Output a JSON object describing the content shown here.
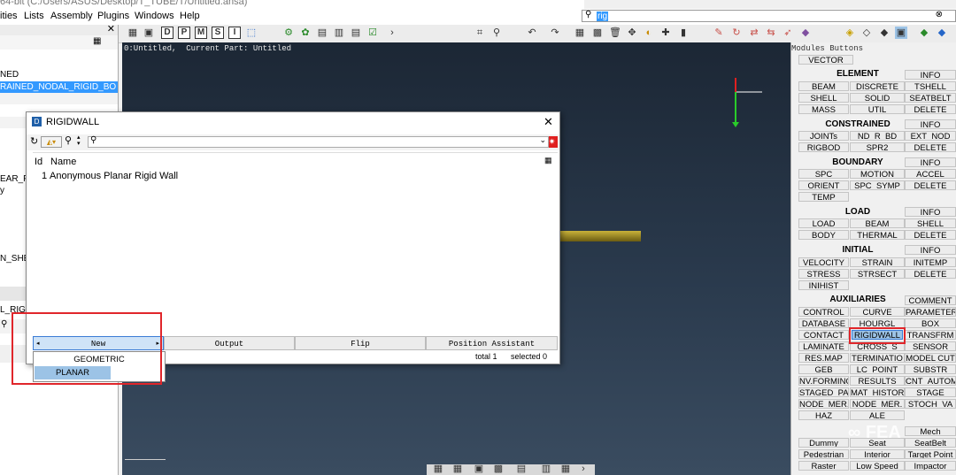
{
  "window": {
    "title": "64-bit (C:/Users/ASUS/Desktop/T_TUBE/T/Untitled.ansa)"
  },
  "menu": [
    "ities",
    "Lists",
    "Assembly",
    "Plugins",
    "Windows",
    "Help"
  ],
  "search": {
    "value": "rig"
  },
  "left_panel": {
    "rows": [
      "NED",
      "RAINED_NODAL_RIGID_BO",
      "EAR_P",
      "y",
      "N_SHEL",
      "L_RIGI"
    ],
    "selected_index": 1
  },
  "viewport": {
    "info": "0:Untitled,  Current Part: Untitled"
  },
  "right_panel": {
    "header": "Modules Buttons",
    "top": "VECTOR",
    "sections": {
      "element": "ELEMENT",
      "constrained": "CONSTRAINED",
      "boundary": "BOUNDARY",
      "load": "LOAD",
      "initial": "INITIAL",
      "auxiliaries": "AUXILIARIES"
    },
    "buttons": {
      "beam": "BEAM",
      "discrete": "DISCRETE",
      "tshell": "TSHELL",
      "info1": "INFO",
      "shell": "SHELL",
      "solid": "SOLID",
      "seatbelt": "SEATBELT",
      "mass": "MASS",
      "util": "UTIL",
      "delete1": "DELETE",
      "info2": "INFO",
      "joints": "JOINTs",
      "nd_r_bd": "ND_R_BD",
      "ext_nod": "EXT_NOD",
      "rigbod": "RIGBOD",
      "spr2": "SPR2",
      "delete2": "DELETE",
      "info3": "INFO",
      "spc": "SPC",
      "motion": "MOTION",
      "accel": "ACCEL",
      "orient": "ORIENT",
      "spc_symp": "SPC_SYMP",
      "delete3": "DELETE",
      "temp": "TEMP",
      "info4": "INFO",
      "load": "LOAD",
      "beam2": "BEAM",
      "shell2": "SHELL",
      "body": "BODY",
      "thermal": "THERMAL",
      "delete4": "DELETE",
      "info5": "INFO",
      "velocity": "VELOCITY",
      "strain": "STRAIN",
      "initemp": "INITEMP",
      "stress": "STRESS",
      "strsect": "STRSECT",
      "delete5": "DELETE",
      "inihist": "INIHIST",
      "comment": "COMMENT",
      "control": "CONTROL",
      "curve": "CURVE",
      "parameter": "PARAMETER",
      "database": "DATABASE",
      "hourgl": "HOURGL",
      "box": "BOX",
      "contact": "CONTACT",
      "rigidwall": "RIGIDWALL",
      "transfrm": "TRANSFRM",
      "laminate": "LAMINATE",
      "cross_s": "CROSS_S",
      "sensor": "SENSOR",
      "resmap": "RES.MAP",
      "terminatio": "TERMINATIO",
      "modelcut": "MODEL CUT",
      "geb": "GEB",
      "lc_point": "LC_POINT",
      "substr": "SUBSTR",
      "nvforming": "NV.FORMING",
      "results": "RESULTS",
      "cnt_autom": "CNT_AUTOM",
      "staged_pa": "STAGED_PA",
      "mat_histor": "MAT_HISTOR",
      "stage": "STAGE",
      "node_mer1": "NODE_MER.",
      "node_mer2": "NODE_MER.",
      "stoch_va": "STOCH_VA",
      "haz": "HAZ",
      "ale": "ALE",
      "mech": "Mech",
      "dummy": "Dummy",
      "seat": "Seat",
      "seatbelt2": "SeatBelt",
      "pedestrian": "Pedestrian",
      "interior": "Interior",
      "targetpoint": "Target Point",
      "raster": "Raster",
      "lowspeed": "Low Speed",
      "impactor": "Impactor"
    }
  },
  "dialog": {
    "title": "RIGIDWALL",
    "columns": {
      "id": "Id",
      "name": "Name"
    },
    "rows": [
      {
        "id": "1",
        "name": "Anonymous Planar Rigid Wall"
      }
    ],
    "buttons": {
      "new": "New",
      "output": "Output",
      "flip": "Flip",
      "position": "Position Assistant"
    },
    "status": {
      "total": "total 1",
      "selected": "selected 0"
    }
  },
  "dropdown": {
    "items": [
      "GEOMETRIC",
      "PLANAR"
    ],
    "selected_index": 1
  },
  "watermark": "FEA",
  "colors": {
    "highlight": "#3399ff",
    "annotation_red": "#e0262b",
    "beam": "#b8a22f",
    "viewport_top": "#1c2735"
  }
}
